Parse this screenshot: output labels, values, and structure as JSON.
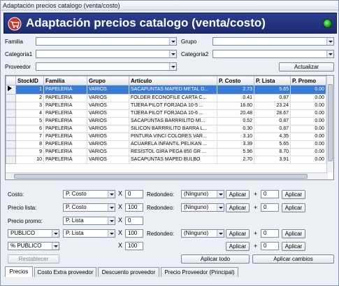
{
  "window": {
    "title": "Adaptación precios catalogo (venta/costo)"
  },
  "banner": {
    "title": "Adaptación precios catalogo (venta/costo)",
    "logo_icon": "cart-logo-icon",
    "status_icon": "green-status-light-icon",
    "accent": "#1f2f7a"
  },
  "filters": {
    "familia_label": "Familia",
    "categoria1_label": "Categoria1",
    "proveedor_label": "Proveedor",
    "grupo_label": "Grupo",
    "categoria2_label": "Categoria2",
    "familia_value": "",
    "categoria1_value": "",
    "proveedor_value": "",
    "grupo_value": "",
    "categoria2_value": "",
    "actualizar_label": "Actualizar"
  },
  "grid": {
    "columns": [
      "StockID",
      "Familia",
      "Grupo",
      "Artículo",
      "P. Costo",
      "P. Lista",
      "P. Promo"
    ],
    "rows": [
      [
        "1",
        "PAPELERIA",
        "VARIOS",
        "SACAPUNTAS MAPED METAL D...",
        "2.73",
        "5.65",
        "0.00"
      ],
      [
        "2",
        "PAPELERIA",
        "VARIOS",
        "FOLDER ECONOFILE CARTA C...",
        "0.41",
        "0.87",
        "0.00"
      ],
      [
        "3",
        "PAPELERIA",
        "VARIOS",
        "TIJERA PILOT FORJADA 10-5 ...",
        "16.60",
        "23.24",
        "0.00"
      ],
      [
        "4",
        "PAPELERIA",
        "VARIOS",
        "TIJERA PILOT FORJADA 10-6 ...",
        "20.48",
        "28.67",
        "0.00"
      ],
      [
        "5",
        "PAPELERIA",
        "VARIOS",
        "SACAPUNTAS BARRRILITO MI...",
        "0.52",
        "0.87",
        "0.00"
      ],
      [
        "6",
        "PAPELERIA",
        "VARIOS",
        "SILICON BARRRILITO BARRA L...",
        "0.30",
        "0.87",
        "0.00"
      ],
      [
        "7",
        "PAPELERIA",
        "VARIOS",
        "PINTURA VINCI COLORES VAR...",
        "3.10",
        "4.35",
        "0.00"
      ],
      [
        "8",
        "PAPELERIA",
        "VARIOS",
        "ACUARELA INFANTIL PELIKAN ...",
        "3.39",
        "5.65",
        "0.00"
      ],
      [
        "9",
        "PAPELERIA",
        "VARIOS",
        "RESISTOL GIRA PEGA 850 GR ...",
        "5.96",
        "8.70",
        "0.00"
      ],
      [
        "10",
        "PAPELERIA",
        "VARIOS",
        "SACAPUNTAS MAPED BULBO",
        "2.70",
        "3.91",
        "0.00"
      ]
    ],
    "selected_row": 0,
    "selection_color": "#3b7bd6"
  },
  "adjust": {
    "costo_label": "Costo:",
    "precio_lista_label": "Precio lista:",
    "precio_promo_label": "Precio promo:",
    "row4_select": "PUBLICO",
    "row5_select": "% PUBLICO",
    "base": [
      "P. Costo",
      "P. Costo",
      "P. Lista",
      "P. Lista"
    ],
    "factor": [
      "0",
      "100",
      "0",
      "100",
      "100"
    ],
    "x_symbol": "X",
    "redondeo_label": "Redondeo:",
    "redondeo": [
      "(Ninguno)",
      "(Ninguno)",
      "(Ninguno)",
      "(Ninguno)"
    ],
    "aplicar_label": "Aplicar",
    "plus_symbol": "+",
    "extra": [
      "0",
      "0",
      "0",
      "0",
      "0"
    ],
    "restablecer_label": "Restablecer",
    "aplicar_todo_label": "Aplicar todo",
    "aplicar_cambios_label": "Aplicar cambios"
  },
  "tabs": [
    {
      "label": "Precios",
      "active": true
    },
    {
      "label": "Costo Extra proveedor",
      "active": false
    },
    {
      "label": "Descuento proveedor",
      "active": false
    },
    {
      "label": "Precio Proveedor (Principal)",
      "active": false
    }
  ]
}
